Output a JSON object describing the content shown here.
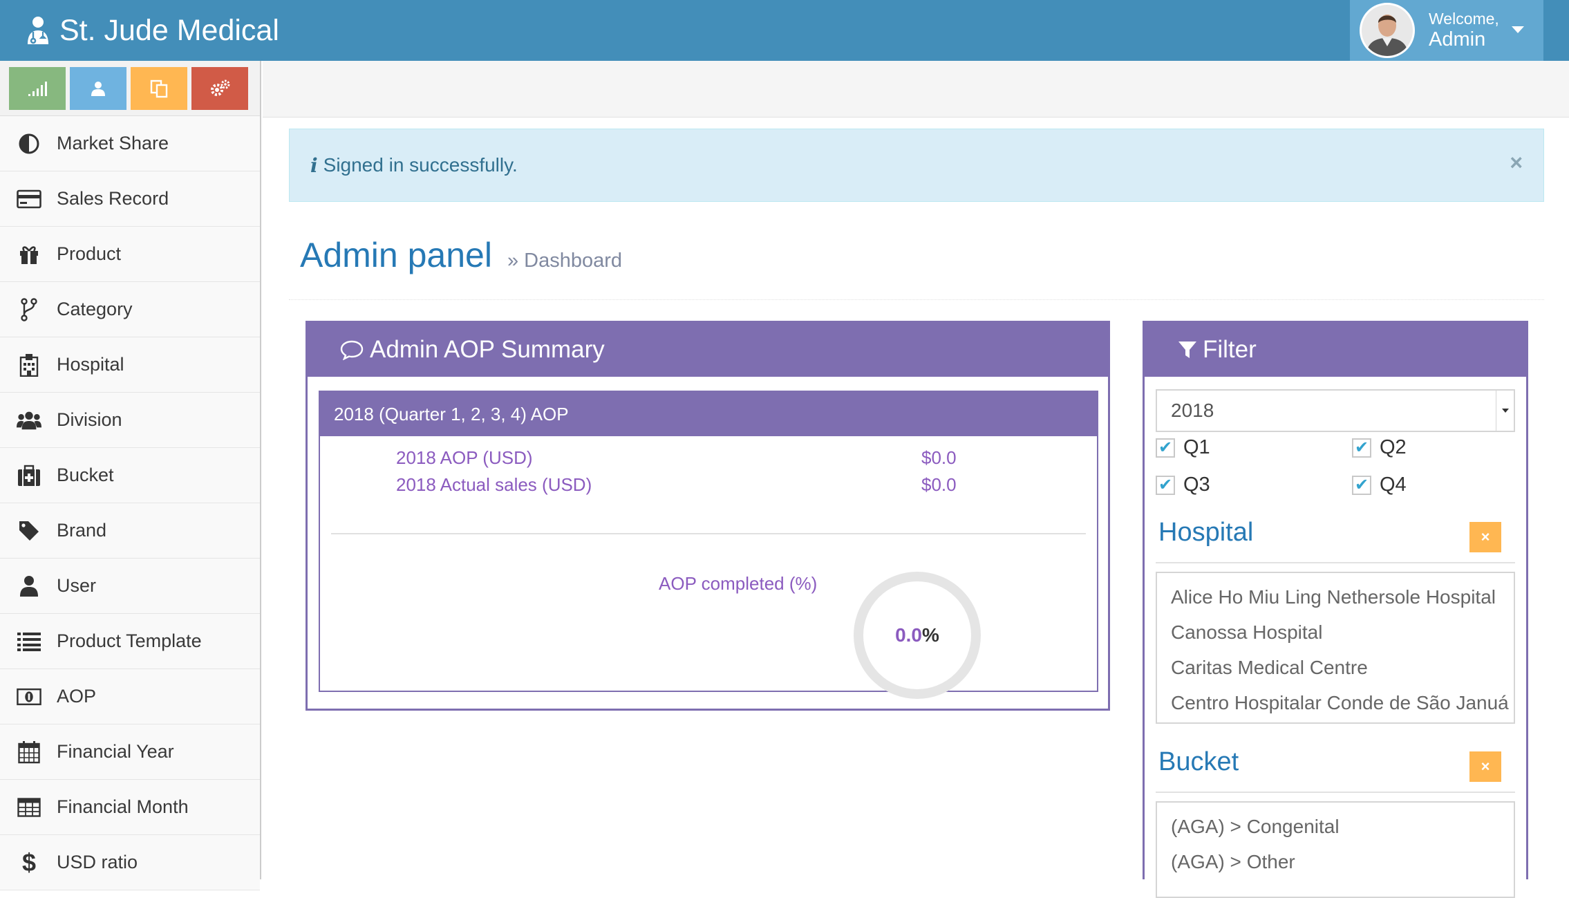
{
  "app": {
    "brand": "St. Jude Medical",
    "welcome": "Welcome,",
    "user": "Admin"
  },
  "sidebar": {
    "shortcuts": [
      {
        "icon": "signal-icon",
        "color": "#87b87f"
      },
      {
        "icon": "user-icon",
        "color": "#6fb3e0"
      },
      {
        "icon": "copy-icon",
        "color": "#ffb752"
      },
      {
        "icon": "cogs-icon",
        "color": "#d15b47"
      }
    ],
    "items": [
      {
        "label": "Market Share",
        "icon": "adjust-icon"
      },
      {
        "label": "Sales Record",
        "icon": "credit-card-icon"
      },
      {
        "label": "Product",
        "icon": "gift-icon"
      },
      {
        "label": "Category",
        "icon": "code-fork-icon"
      },
      {
        "label": "Hospital",
        "icon": "hospital-icon"
      },
      {
        "label": "Division",
        "icon": "users-icon"
      },
      {
        "label": "Bucket",
        "icon": "medkit-icon"
      },
      {
        "label": "Brand",
        "icon": "tag-icon"
      },
      {
        "label": "User",
        "icon": "user-icon"
      },
      {
        "label": "Product Template",
        "icon": "list-icon"
      },
      {
        "label": "AOP",
        "icon": "money-icon"
      },
      {
        "label": "Financial Year",
        "icon": "calendar-icon"
      },
      {
        "label": "Financial Month",
        "icon": "table-icon"
      },
      {
        "label": "USD ratio",
        "icon": "dollar-icon"
      }
    ]
  },
  "alert": {
    "message": "Signed in successfully.",
    "info_glyph": "i",
    "close_glyph": "×"
  },
  "header": {
    "title": "Admin panel",
    "breadcrumb_sep": "»",
    "breadcrumb": "Dashboard"
  },
  "aop": {
    "title": "Admin AOP Summary",
    "subtitle": "2018 (Quarter 1, 2, 3, 4) AOP",
    "rows": [
      {
        "label": "2018 AOP (USD)",
        "value": "$0.0"
      },
      {
        "label": "2018 Actual sales (USD)",
        "value": "$0.0"
      }
    ],
    "completed_label": "AOP completed (%)",
    "completed_value": "0.0",
    "completed_suffix": "%"
  },
  "filter": {
    "title": "Filter",
    "year": "2018",
    "quarters": [
      {
        "label": "Q1",
        "checked": true
      },
      {
        "label": "Q2",
        "checked": true
      },
      {
        "label": "Q3",
        "checked": true
      },
      {
        "label": "Q4",
        "checked": true
      }
    ],
    "hospital_title": "Hospital",
    "hospitals": [
      "Alice Ho Miu Ling Nethersole Hospital",
      "Canossa Hospital",
      "Caritas Medical Centre",
      "Centro Hospitalar Conde de São Januá"
    ],
    "bucket_title": "Bucket",
    "buckets": [
      "(AGA) > Congenital",
      "(AGA) > Other"
    ],
    "clear_glyph": "×",
    "check_glyph": "✔"
  }
}
